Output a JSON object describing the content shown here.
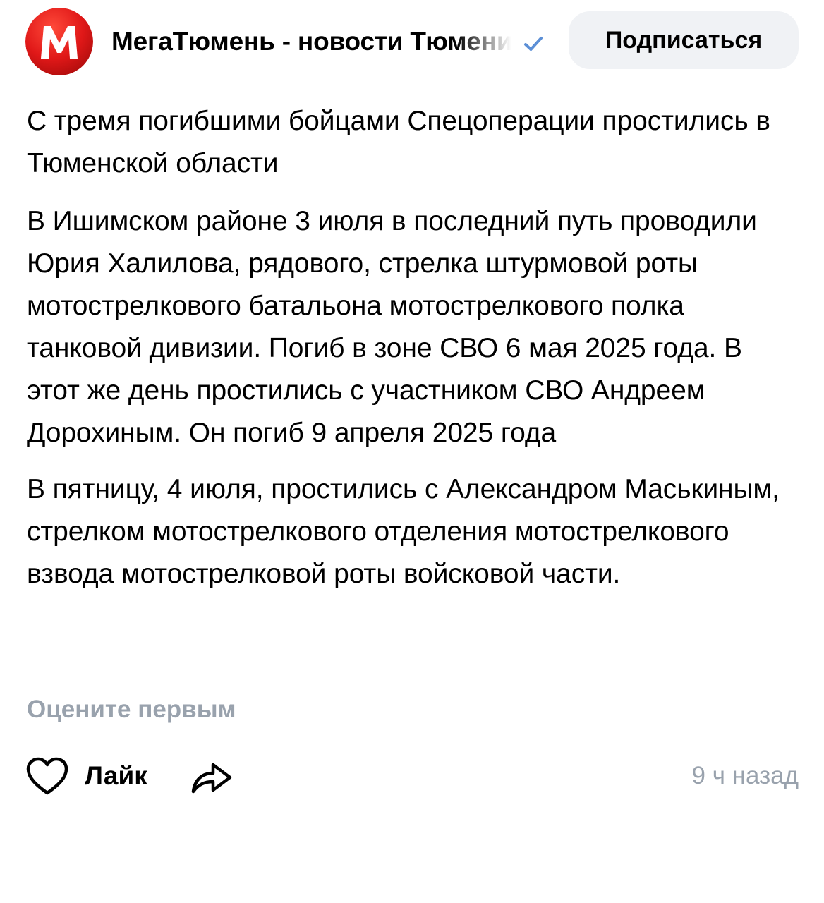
{
  "header": {
    "avatar_letter": "M",
    "channel_name": "МегаТюмень - новости Тюмени",
    "verified_icon": "check-icon",
    "subscribe_label": "Подписаться"
  },
  "post": {
    "title": "С тремя погибшими бойцами Спецоперации простились в Тюменской области",
    "paragraphs": [
      "В Ишимском районе 3 июля в последний путь проводили Юрия Халилова, рядового, стрелка штурмовой роты мотострелкового батальона мотострелкового полка танковой дивизии. Погиб в зоне СВО 6 мая 2025 года. В этот же день простились с участником СВО Андреем Дорохиным. Он погиб 9 апреля 2025 года",
      "В пятницу, 4 июля, простились с Александром Маськиным, стрелком мотострелкового отделения мотострелкового взвода мотострелковой роты войсковой части."
    ],
    "rate_label": "Оцените первым"
  },
  "footer": {
    "like_icon": "heart-outline-icon",
    "like_label": "Лайк",
    "share_icon": "share-arrow-icon",
    "timestamp": "9 ч назад"
  },
  "colors": {
    "brand_red": "#e01818",
    "verified_blue": "#5c8fd6",
    "muted_text": "#99a2ad",
    "button_bg": "#f0f2f5"
  }
}
